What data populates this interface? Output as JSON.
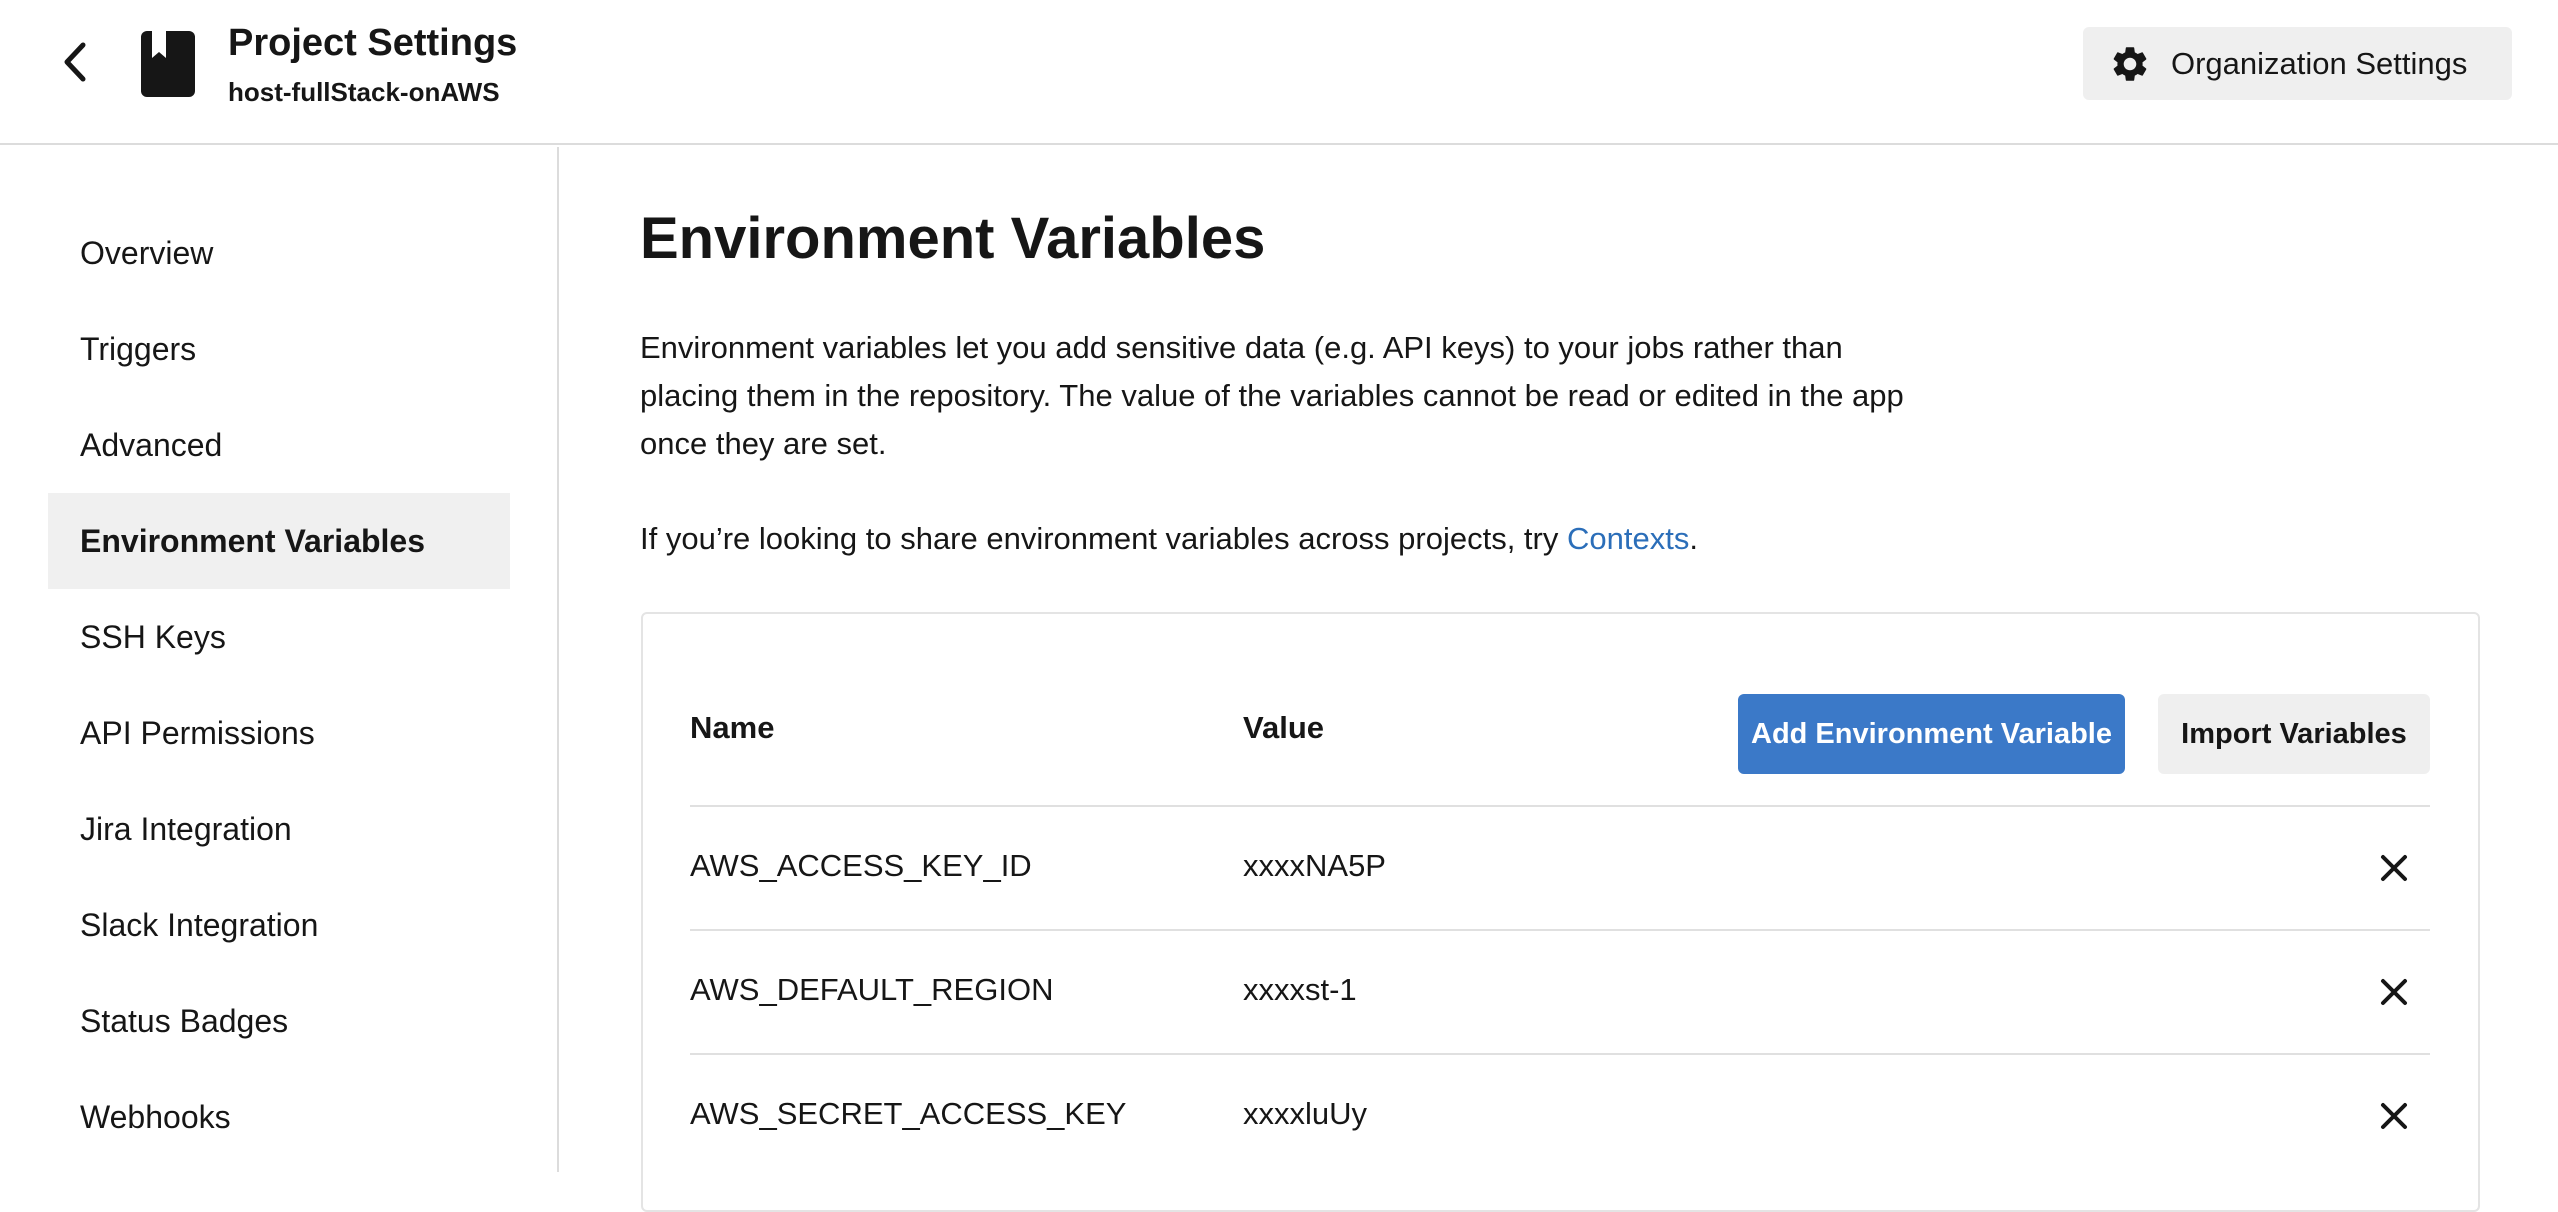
{
  "header": {
    "title": "Project Settings",
    "subtitle": "host-fullStack-onAWS",
    "back_icon": "chevron-left-icon",
    "project_icon": "bookmark-icon",
    "org_settings_label": "Organization Settings",
    "org_settings_icon": "gear-icon"
  },
  "sidebar": {
    "items": [
      {
        "label": "Overview",
        "active": false
      },
      {
        "label": "Triggers",
        "active": false
      },
      {
        "label": "Advanced",
        "active": false
      },
      {
        "label": "Environment Variables",
        "active": true
      },
      {
        "label": "SSH Keys",
        "active": false
      },
      {
        "label": "API Permissions",
        "active": false
      },
      {
        "label": "Jira Integration",
        "active": false
      },
      {
        "label": "Slack Integration",
        "active": false
      },
      {
        "label": "Status Badges",
        "active": false
      },
      {
        "label": "Webhooks",
        "active": false
      }
    ]
  },
  "main": {
    "title": "Environment Variables",
    "description": "Environment variables let you add sensitive data (e.g. API keys) to your jobs rather than placing them in the repository. The value of the variables cannot be read or edited in the app once they are set.",
    "contexts_prefix": "If you’re looking to share environment variables across projects, try ",
    "contexts_link": "Contexts",
    "contexts_suffix": ".",
    "table": {
      "columns": {
        "name": "Name",
        "value": "Value"
      },
      "add_button_label": "Add Environment Variable",
      "import_button_label": "Import Variables",
      "rows": [
        {
          "name": "AWS_ACCESS_KEY_ID",
          "value": "xxxxNA5P"
        },
        {
          "name": "AWS_DEFAULT_REGION",
          "value": "xxxxst-1"
        },
        {
          "name": "AWS_SECRET_ACCESS_KEY",
          "value": "xxxxluUy"
        }
      ],
      "delete_icon": "close-icon"
    }
  },
  "colors": {
    "accent": "#3b79c8",
    "link": "#2b6eb9",
    "active_sidebar_bg": "#f0f0f0",
    "button_gray": "#efefef"
  }
}
